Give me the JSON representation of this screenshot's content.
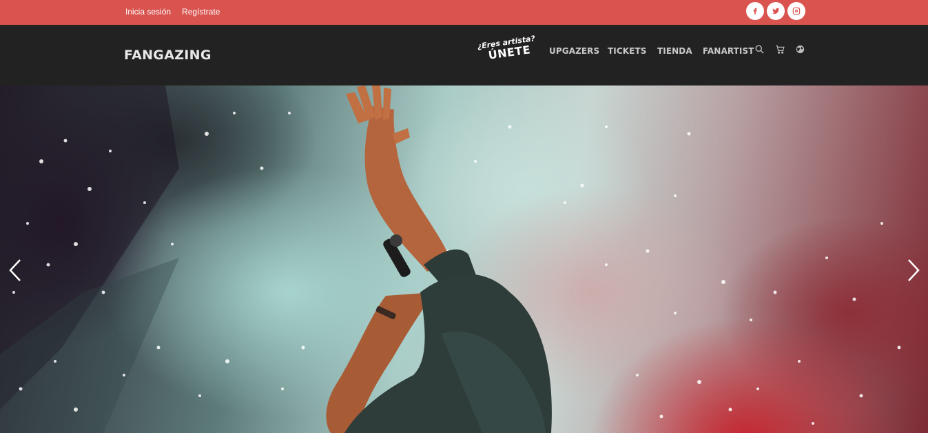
{
  "topbar": {
    "login_label": "Inicia sesión",
    "register_label": "Regístrate",
    "social": [
      "facebook-icon",
      "twitter-icon",
      "instagram-icon"
    ]
  },
  "navbar": {
    "logo_text": "FANGAZING",
    "artist_cta": {
      "question": "¿Eres artista?",
      "action": "ÚNETE"
    },
    "menu": [
      {
        "label": "UPGAZERS"
      },
      {
        "label": "TICKETS"
      },
      {
        "label": "TIENDA"
      },
      {
        "label": "FANARTIST"
      }
    ],
    "icons": [
      "search-icon",
      "cart-icon",
      "globe-icon"
    ]
  },
  "hero": {
    "image_description": "concert-performer-raised-hand",
    "prev_icon": "chevron-left-icon",
    "next_icon": "chevron-right-icon"
  },
  "colors": {
    "topbar_bg": "#d9534f",
    "navbar_bg": "#222222",
    "menu_text": "#c9c9c9"
  }
}
